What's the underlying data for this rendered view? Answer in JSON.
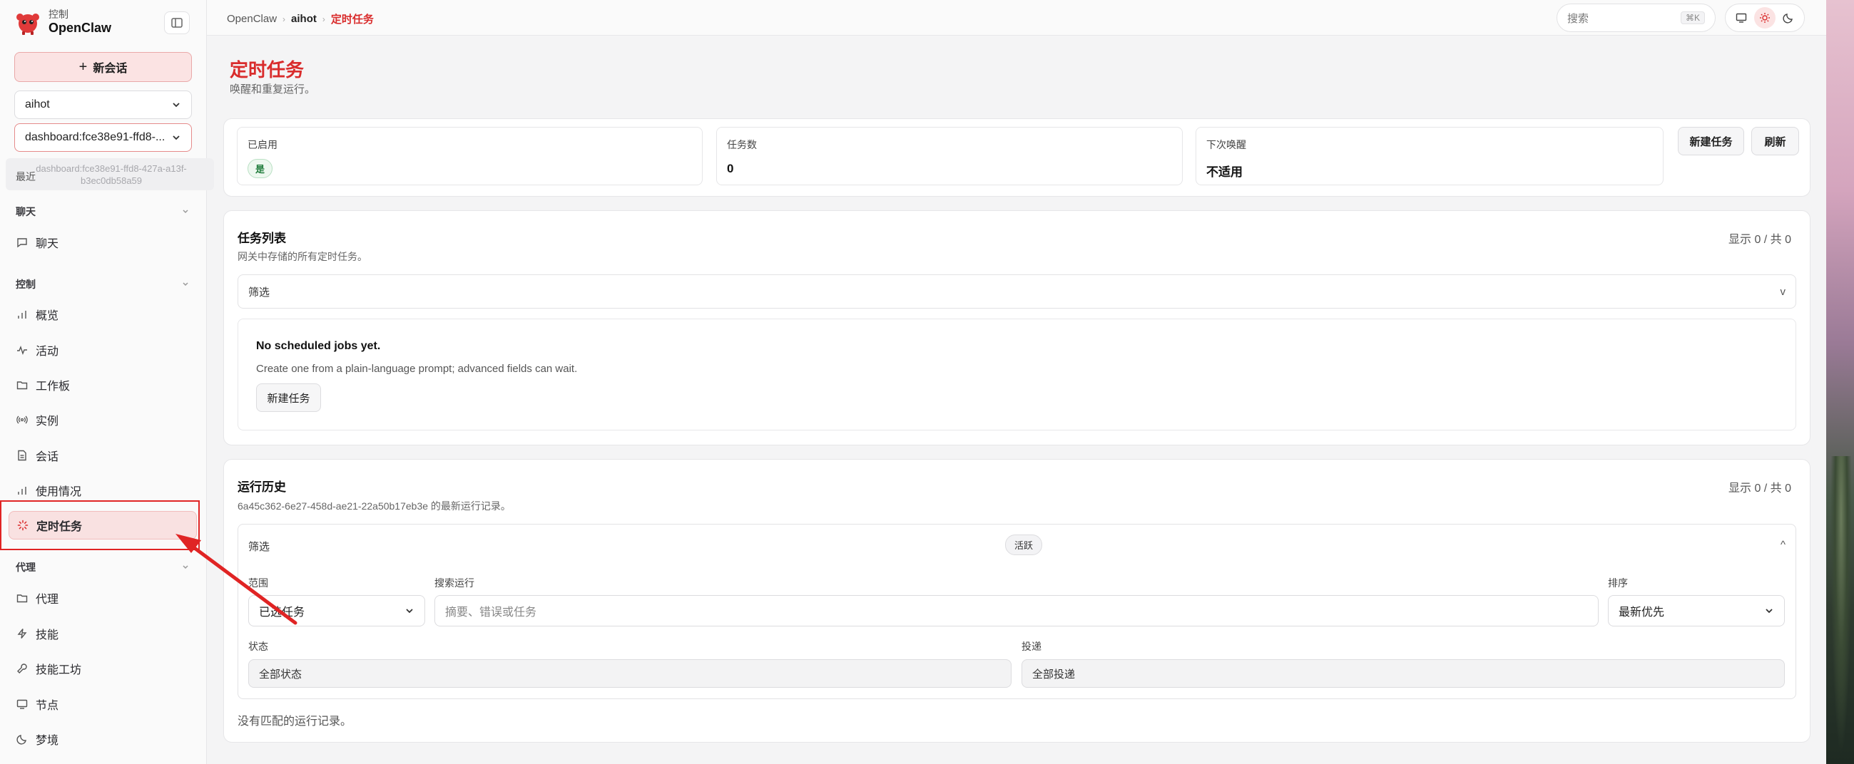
{
  "brand": {
    "subtitle": "控制",
    "name": "OpenClaw"
  },
  "sidebar": {
    "new_chat": "新会话",
    "agent_select": "aihot",
    "session_select": "dashboard:fce38e91-ffd8-...",
    "recent_label": "最近",
    "tooltip": "dashboard:fce38e91-ffd8-427a-a13f-b3ec0db58a59",
    "sections": [
      {
        "title": "聊天",
        "items": [
          {
            "label": "聊天",
            "icon": "chat-icon"
          }
        ]
      },
      {
        "title": "控制",
        "items": [
          {
            "label": "概览",
            "icon": "bar-chart-icon"
          },
          {
            "label": "活动",
            "icon": "activity-icon"
          },
          {
            "label": "工作板",
            "icon": "folder-icon"
          },
          {
            "label": "实例",
            "icon": "broadcast-icon"
          },
          {
            "label": "会话",
            "icon": "document-icon"
          },
          {
            "label": "使用情况",
            "icon": "bar-chart-icon"
          },
          {
            "label": "定时任务",
            "icon": "loader-icon"
          }
        ]
      },
      {
        "title": "代理",
        "items": [
          {
            "label": "代理",
            "icon": "folder-icon"
          },
          {
            "label": "技能",
            "icon": "lightning-icon"
          },
          {
            "label": "技能工坊",
            "icon": "wrench-icon"
          },
          {
            "label": "节点",
            "icon": "monitor-icon"
          },
          {
            "label": "梦境",
            "icon": "moon-icon"
          }
        ]
      }
    ]
  },
  "topbar": {
    "breadcrumb": [
      "OpenClaw",
      "aihot",
      "定时任务"
    ],
    "search_placeholder": "搜索",
    "search_shortcut": "⌘K"
  },
  "page": {
    "title": "定时任务",
    "subtitle": "唤醒和重复运行。"
  },
  "stats": [
    {
      "label": "已启用",
      "badge": "是"
    },
    {
      "label": "任务数",
      "value": "0"
    },
    {
      "label": "下次唤醒",
      "value": "不适用"
    }
  ],
  "actions": {
    "new_job": "新建任务",
    "refresh": "刷新"
  },
  "job_list": {
    "title": "任务列表",
    "description": "网关中存储的所有定时任务。",
    "count": "显示 0 / 共 0",
    "filter_label": "筛选",
    "filter_toggle": "v",
    "empty_title": "No scheduled jobs yet.",
    "empty_text": "Create one from a plain-language prompt; advanced fields can wait.",
    "empty_button": "新建任务"
  },
  "run_history": {
    "title": "运行历史",
    "description": "6a45c362-6e27-458d-ae21-22a50b17eb3e 的最新运行记录。",
    "count": "显示 0 / 共 0",
    "filter_label": "筛选",
    "filter_pill": "活跃",
    "filter_toggle": "^",
    "scope_label": "范围",
    "scope_value": "已选任务",
    "search_label": "搜索运行",
    "search_placeholder": "摘要、错误或任务",
    "sort_label": "排序",
    "sort_value": "最新优先",
    "status_label": "状态",
    "status_value": "全部状态",
    "delivery_label": "投递",
    "delivery_value": "全部投递",
    "empty_text": "没有匹配的运行记录。"
  },
  "colors": {
    "accent": "#d92c2c",
    "accent_bg": "#fbe3e3",
    "annotation": "#e02424"
  }
}
